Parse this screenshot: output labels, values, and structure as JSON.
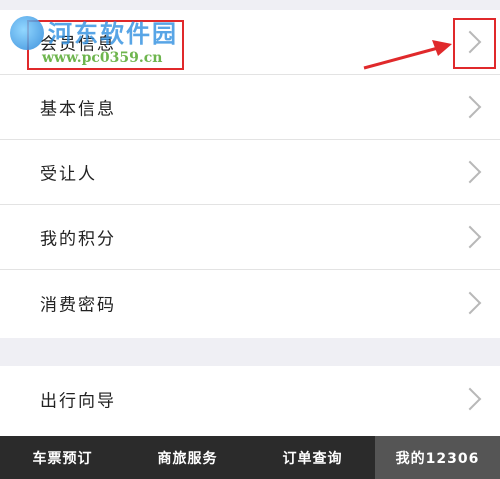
{
  "group1": {
    "items": [
      {
        "label": "会员信息"
      },
      {
        "label": "基本信息"
      },
      {
        "label": "受让人"
      },
      {
        "label": "我的积分"
      },
      {
        "label": "消费密码"
      }
    ]
  },
  "group2": {
    "items": [
      {
        "label": "出行向导"
      }
    ]
  },
  "watermark": {
    "title": "河东软件园",
    "url": "www.pc0359.cn"
  },
  "tabbar": {
    "tabs": [
      {
        "label": "车票预订"
      },
      {
        "label": "商旅服务"
      },
      {
        "label": "订单查询"
      },
      {
        "label": "我的12306"
      }
    ]
  },
  "colors": {
    "annotation_red": "#e0292b",
    "tabbar_bg": "#2b2b2b",
    "tab_active_bg": "#555555",
    "page_bg": "#efeff4"
  },
  "icons": {
    "row_chevron": "chevron-right-icon",
    "annotation_arrow": "red-arrow-icon"
  }
}
